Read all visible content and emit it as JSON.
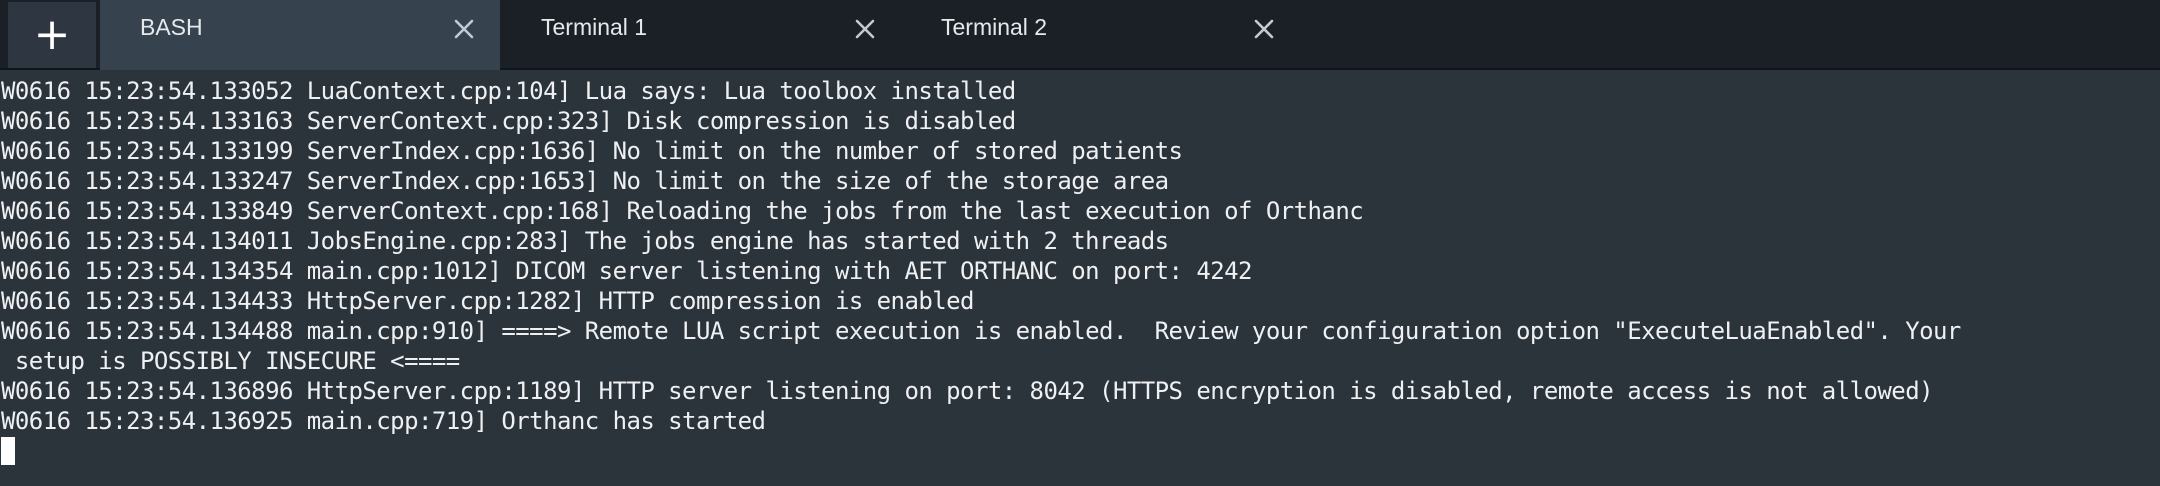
{
  "toolbar": {
    "add_label": "+"
  },
  "tabs": [
    {
      "label": "BASH",
      "active": true
    },
    {
      "label": "Terminal 1",
      "active": false
    },
    {
      "label": "Terminal 2",
      "active": false
    }
  ],
  "terminal": {
    "lines": [
      "W0616 15:23:54.133052 LuaContext.cpp:104] Lua says: Lua toolbox installed",
      "W0616 15:23:54.133163 ServerContext.cpp:323] Disk compression is disabled",
      "W0616 15:23:54.133199 ServerIndex.cpp:1636] No limit on the number of stored patients",
      "W0616 15:23:54.133247 ServerIndex.cpp:1653] No limit on the size of the storage area",
      "W0616 15:23:54.133849 ServerContext.cpp:168] Reloading the jobs from the last execution of Orthanc",
      "W0616 15:23:54.134011 JobsEngine.cpp:283] The jobs engine has started with 2 threads",
      "W0616 15:23:54.134354 main.cpp:1012] DICOM server listening with AET ORTHANC on port: 4242",
      "W0616 15:23:54.134433 HttpServer.cpp:1282] HTTP compression is enabled",
      "W0616 15:23:54.134488 main.cpp:910] ====> Remote LUA script execution is enabled.  Review your configuration option \"ExecuteLuaEnabled\". Your",
      " setup is POSSIBLY INSECURE <====",
      "W0616 15:23:54.136896 HttpServer.cpp:1189] HTTP server listening on port: 8042 (HTTPS encryption is disabled, remote access is not allowed)",
      "W0616 15:23:54.136925 main.cpp:719] Orthanc has started"
    ]
  }
}
